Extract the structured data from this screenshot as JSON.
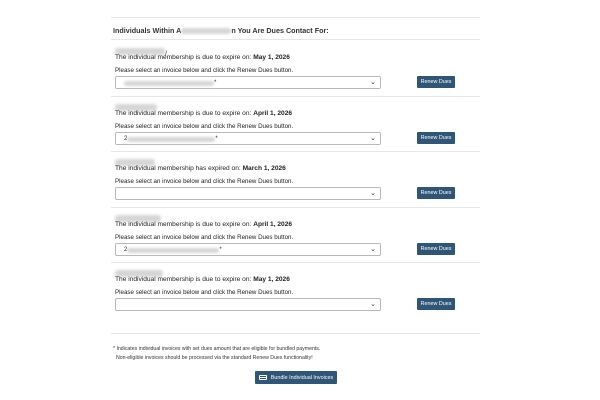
{
  "heading": {
    "prefix": "Individuals Within A",
    "suffix": "n You Are Dues Contact For:"
  },
  "members": [
    {
      "name_suffix": "/",
      "status_text": "The individual membership is due to expire on:",
      "date": "May 1, 2026",
      "instruction": "Please select an invoice below and click the Renew Dues button.",
      "select_prefix": "",
      "select_suffix": "*",
      "renew_label": "Renew Dues"
    },
    {
      "name_suffix": "",
      "status_text": "The individual membership is due to expire on:",
      "date": "April 1, 2026",
      "instruction": "Please select an invoice below and click the Renew Dues button.",
      "select_prefix": "2",
      "select_suffix": "*",
      "renew_label": "Renew Dues"
    },
    {
      "name_suffix": "",
      "status_text": "The individual membership has expired on:",
      "date": "March 1, 2026",
      "instruction": "Please select an invoice below and click the Renew Dues button.",
      "select_prefix": "",
      "select_suffix": "",
      "renew_label": "Renew Dues"
    },
    {
      "name_suffix": "",
      "status_text": "The individual membership is due to expire on:",
      "date": "April 1, 2026",
      "instruction": "Please select an invoice below and click the Renew Dues button.",
      "select_prefix": "2",
      "select_suffix": "*",
      "renew_label": "Renew Dues"
    },
    {
      "name_suffix": "",
      "status_text": "The individual membership is due to expire on:",
      "date": "May 1, 2026",
      "instruction": "Please select an invoice below and click the Renew Dues button.",
      "select_prefix": "",
      "select_suffix": "",
      "renew_label": "Renew Dues"
    }
  ],
  "footnote": {
    "line1": "* Indicates individual invoices with set dues amount that are eligible for bundled payments.",
    "line2": "Non-eligible invoices should be processed via the standard Renew Dues functionality!"
  },
  "bundle_label": "Bundle Individual Invoices",
  "colors": {
    "button": "#2f5577",
    "rule": "#e6e6e6",
    "redacted": "#d6d6d6"
  }
}
